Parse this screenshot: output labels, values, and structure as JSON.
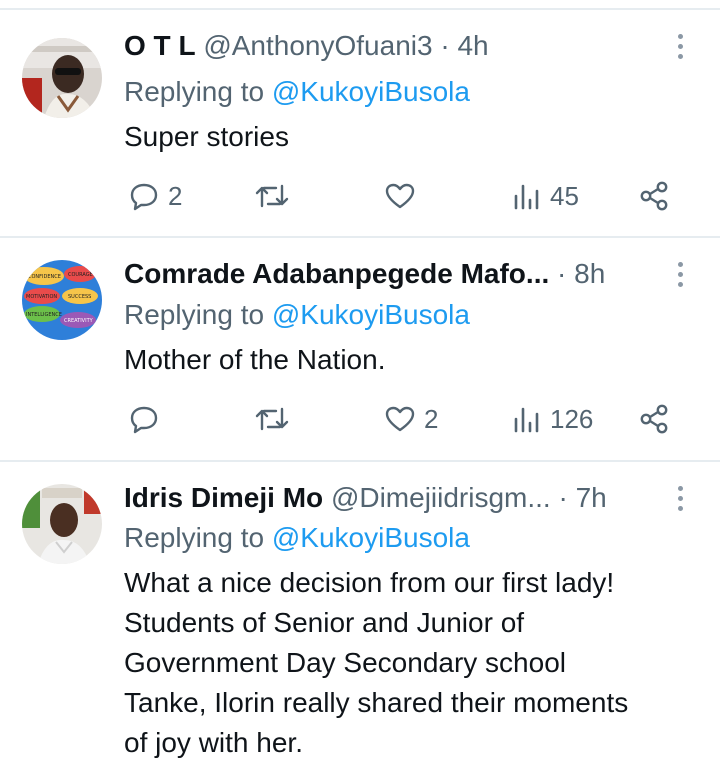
{
  "replies": [
    {
      "name": "O T L",
      "handle": "@AnthonyOfuani3",
      "time": "· 4h",
      "replying_prefix": "Replying to",
      "replying_to": "@KukoyiBusola",
      "text": "Super stories",
      "replies_count": "2",
      "retweets_count": "",
      "likes_count": "",
      "views_count": "45"
    },
    {
      "name": "Comrade Adabanpegede Mafo...",
      "handle": "",
      "time": "· 8h",
      "replying_prefix": "Replying to",
      "replying_to": "@KukoyiBusola",
      "text": "Mother of the Nation.",
      "replies_count": "",
      "retweets_count": "",
      "likes_count": "2",
      "views_count": "126",
      "avatar_words": [
        "CONFIDENCE",
        "COURAGE",
        "MOTIVATION",
        "SUCCESS",
        "INTELLIGENCE",
        "CREATIVITY"
      ]
    },
    {
      "name": "Idris Dimeji Mo",
      "handle": "@Dimejiidrisgm...",
      "time": "· 7h",
      "replying_prefix": "Replying to",
      "replying_to": "@KukoyiBusola",
      "text_lines": [
        "What a nice decision from our first lady!",
        "Students of Senior and Junior of",
        "Government Day Secondary school",
        "Tanke, Ilorin really shared their moments",
        "of joy with her."
      ]
    }
  ],
  "colors": {
    "text": "#0f1419",
    "secondary": "#536471",
    "accent": "#1d9bf0",
    "divider": "#e6ecf0"
  },
  "icons": [
    "reply-icon",
    "retweet-icon",
    "like-icon",
    "views-icon",
    "share-icon",
    "more-icon"
  ]
}
